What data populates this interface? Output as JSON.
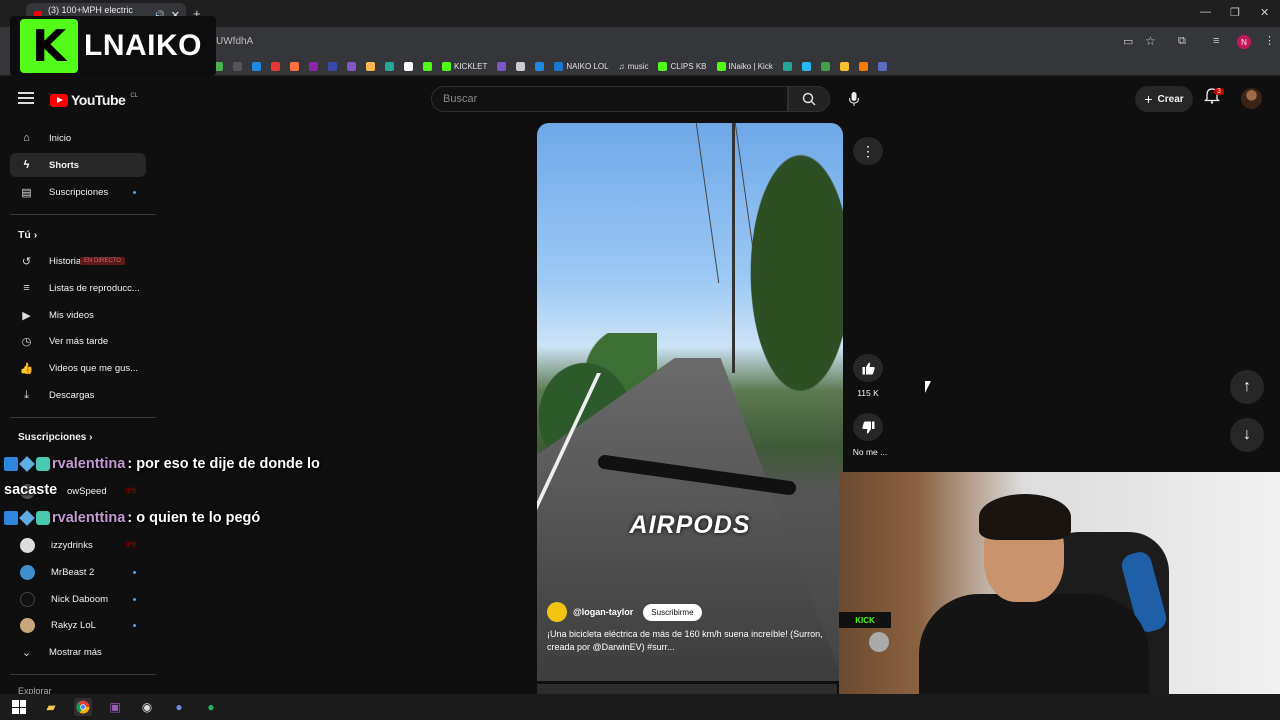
{
  "browser": {
    "tab_title": "(3) 100+MPH electric bike...",
    "url_fragment": "UWfdhA",
    "bookmarks": [
      "KICKLET",
      "NAIKO LOL",
      "music",
      "CLIPS KB",
      "INaiko | Kick"
    ],
    "profile_initial": "N"
  },
  "overlay": {
    "logo_text": "LNAIKO",
    "kick_letter": "K"
  },
  "youtube": {
    "logo": "YouTube",
    "country": "CL",
    "search_placeholder": "Buscar",
    "create_label": "Crear",
    "notifications": "3"
  },
  "sidebar": {
    "main": [
      {
        "label": "Inicio",
        "icon": "home-icon"
      },
      {
        "label": "Shorts",
        "icon": "shorts-icon"
      },
      {
        "label": "Suscripciones",
        "icon": "subscriptions-icon"
      }
    ],
    "you_header": "Tú",
    "you_items": [
      {
        "label": "Historial"
      },
      {
        "label": "Listas de reproducc..."
      },
      {
        "label": "Mis videos"
      },
      {
        "label": "Ver más tarde"
      },
      {
        "label": "Videos que me gus..."
      },
      {
        "label": "Descargas"
      }
    ],
    "live_tag": "EN DIRECTO",
    "subs_header": "Suscripciones",
    "channels": [
      {
        "label": "owSpeed"
      },
      {
        "label": "izzydrinks"
      },
      {
        "label": "MrBeast 2"
      },
      {
        "label": "Nick Daboom"
      },
      {
        "label": "Rakyz LoL"
      }
    ],
    "show_more": "Mostrar más",
    "explore": "Explorar"
  },
  "chat": [
    {
      "user": "rvalenttina",
      "message": ": por eso te dije de donde lo",
      "continuation": "sacaste"
    },
    {
      "user": "rvalenttina",
      "message": ": o quien te lo pegó"
    }
  ],
  "short": {
    "overlay_text": "AIRPODS",
    "channel": "@logan-taylor",
    "subscribe": "Suscribirme",
    "description": "¡Una bicicleta eléctrica de más de 160 km/h suena increíble! (Surron, creada por @DarwinEV) #surr...",
    "likes": "115 K",
    "dislike_label": "No me ..."
  }
}
